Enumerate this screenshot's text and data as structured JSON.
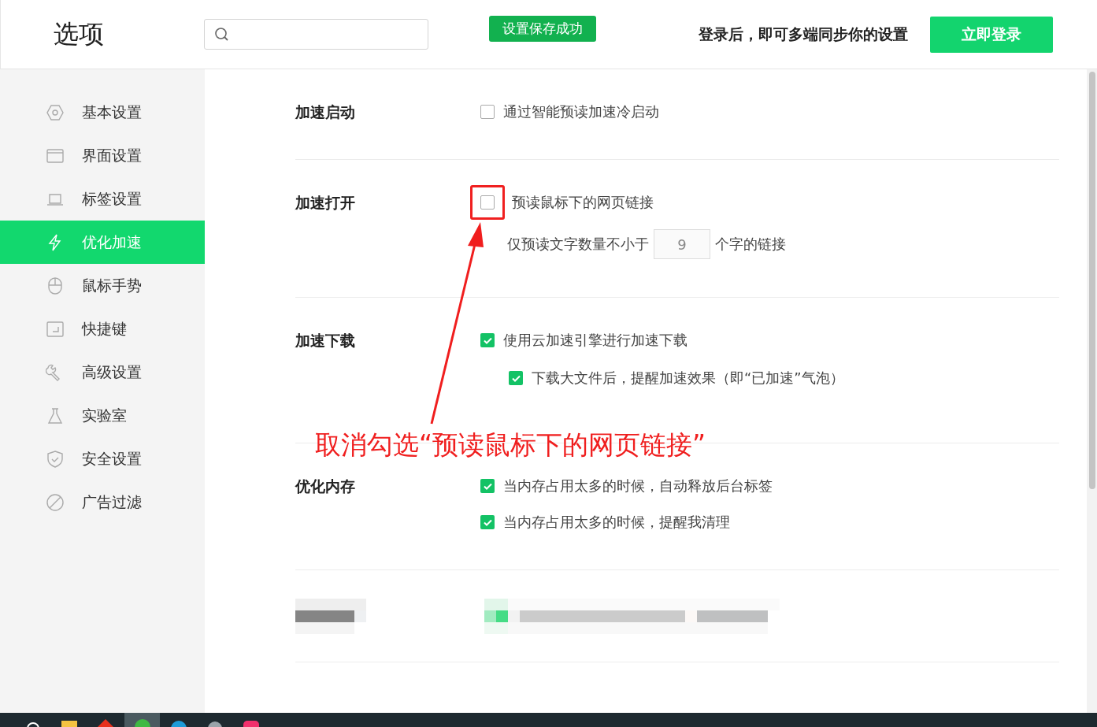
{
  "header": {
    "title": "选项",
    "toast": "设置保存成功",
    "login_prompt": "登录后，即可多端同步你的设置",
    "login_button": "立即登录"
  },
  "sidebar": {
    "items": [
      {
        "label": "基本设置",
        "selected": false
      },
      {
        "label": "界面设置",
        "selected": false
      },
      {
        "label": "标签设置",
        "selected": false
      },
      {
        "label": "优化加速",
        "selected": true
      },
      {
        "label": "鼠标手势",
        "selected": false
      },
      {
        "label": "快捷键",
        "selected": false
      },
      {
        "label": "高级设置",
        "selected": false
      },
      {
        "label": "实验室",
        "selected": false
      },
      {
        "label": "安全设置",
        "selected": false
      },
      {
        "label": "广告过滤",
        "selected": false
      }
    ]
  },
  "sections": [
    {
      "title": "加速启动",
      "options": [
        {
          "kind": "checkbox",
          "label": "通过智能预读加速冷启动",
          "checked": false
        }
      ]
    },
    {
      "title": "加速打开",
      "options": [
        {
          "kind": "checkbox",
          "label": "预读鼠标下的网页链接",
          "checked": false,
          "highlighted": true
        },
        {
          "kind": "number",
          "label_before": "仅预读文字数量不小于",
          "value": "9",
          "label_after": "个字的链接"
        }
      ]
    },
    {
      "title": "加速下载",
      "options": [
        {
          "kind": "checkbox",
          "label": "使用云加速引擎进行加速下载",
          "checked": true,
          "children": [
            {
              "kind": "checkbox",
              "label": "下载大文件后，提醒加速效果（即“已加速”气泡）",
              "checked": true
            }
          ]
        }
      ]
    },
    {
      "title": "优化内存",
      "options": [
        {
          "kind": "checkbox",
          "label": "当内存占用太多的时候，自动释放后台标签",
          "checked": true
        },
        {
          "kind": "checkbox",
          "label": "当内存占用太多的时候，提醒我清理",
          "checked": true
        }
      ]
    },
    {
      "kind": "blurred"
    }
  ],
  "annotation": {
    "text": "取消勾选“预读鼠标下的网页链接”"
  }
}
